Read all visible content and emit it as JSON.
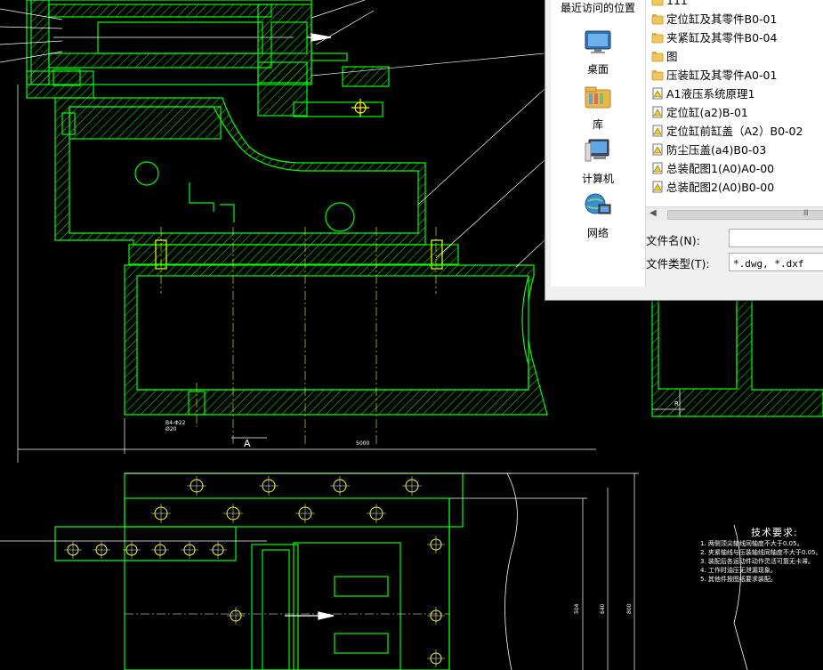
{
  "cad": {
    "colors": {
      "green": "#00ff00",
      "white": "#ffffff",
      "yellow": "#ffff00",
      "bg": "#000000"
    },
    "view_label": "A",
    "overall_dim": "5000",
    "small_dim": "R",
    "dim_504": "504",
    "dim_640": "640",
    "dim_800": "800",
    "callout_1": "B4-Φ22",
    "callout_2": "Ø20",
    "tech_title": "技术要求:",
    "tech_lines": [
      "1. 两侧顶尖轴线同轴度不大于0.05。",
      "2. 夹紧轴线与压装轴线同轴度不大于0.05。",
      "3. 装配后各运动件动作灵活可靠无卡滞。",
      "4. 工作时油压无泄漏现象。",
      "5. 其他件按图纸要求装配。"
    ]
  },
  "dialog": {
    "places": [
      {
        "label": "最近访问的位置",
        "icon": "recent-places-icon"
      },
      {
        "label": "桌面",
        "icon": "desktop-icon"
      },
      {
        "label": "库",
        "icon": "library-icon"
      },
      {
        "label": "计算机",
        "icon": "computer-icon"
      },
      {
        "label": "网络",
        "icon": "network-icon"
      }
    ],
    "files": [
      {
        "name": "111",
        "type": "folder"
      },
      {
        "name": "定位缸及其零件B0-01",
        "type": "folder"
      },
      {
        "name": "夹紧缸及其零件B0-04",
        "type": "folder"
      },
      {
        "name": "图",
        "type": "folder"
      },
      {
        "name": "压装缸及其零件A0-01",
        "type": "folder"
      },
      {
        "name": "A1液压系统原理1",
        "type": "dwg"
      },
      {
        "name": "定位缸(a2)B-01",
        "type": "dwg"
      },
      {
        "name": "定位缸前缸盖（A2）B0-02",
        "type": "dwg"
      },
      {
        "name": "防尘压盖(a4)B0-03",
        "type": "dwg"
      },
      {
        "name": "总装配图1(A0)A0-00",
        "type": "dwg"
      },
      {
        "name": "总装配图2(A0)B0-00",
        "type": "dwg"
      }
    ],
    "filename_label": "文件名(N):",
    "filename_value": "",
    "filetype_label": "文件类型(T):",
    "filetype_value": "*.dwg, *.dxf",
    "scroll_grip": "III"
  }
}
